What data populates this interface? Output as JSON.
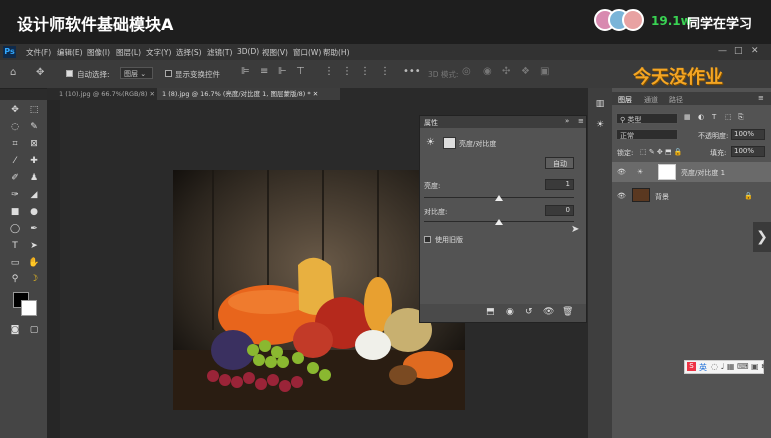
{
  "topbar": {
    "course_title": "设计师软件基础模块A",
    "viewer_count": "19.1w",
    "status_text": "同学在学习"
  },
  "ps": {
    "logo": "Ps",
    "menu": [
      "文件(F)",
      "编辑(E)",
      "图像(I)",
      "图层(L)",
      "文字(Y)",
      "选择(S)",
      "滤镜(T)",
      "3D(D)",
      "视图(V)",
      "窗口(W)",
      "帮助(H)"
    ],
    "window_controls": [
      "—",
      "□",
      "✕"
    ]
  },
  "options": {
    "auto_select_label": "自动选择:",
    "auto_select_value": "图层",
    "show_transform_label": "显示变换控件",
    "mode_3d_label": "3D 模式:"
  },
  "overlay_text": "今天没作业",
  "tabs": [
    {
      "label": "1 (10).jpg @ 66.7%(RGB/8)",
      "close": "✕"
    },
    {
      "label": "1 (8).jpg @ 16.7% (亮度/对比度 1, 图层蒙版/8) *",
      "close": "✕"
    }
  ],
  "properties": {
    "panel_tab": "属性",
    "adjustment_name": "亮度/对比度",
    "auto_button": "自动",
    "brightness_label": "亮度:",
    "brightness_value": "1",
    "contrast_label": "对比度:",
    "contrast_value": "0",
    "legacy_label": "使用旧版",
    "brightness_fraction": 0.5,
    "contrast_fraction": 0.5
  },
  "layers_panel": {
    "tabs": [
      "图层",
      "通道",
      "路径"
    ],
    "filter_kind": "类型",
    "blend_mode": "正常",
    "opacity_label": "不透明度:",
    "opacity_value": "100%",
    "lock_label": "锁定:",
    "fill_label": "填充:",
    "fill_value": "100%",
    "layers": [
      {
        "name": "亮度/对比度 1"
      },
      {
        "name": "背景"
      }
    ]
  },
  "ime": {
    "label": "英"
  },
  "colors": {
    "accent": "#31a8ff",
    "overlay": "#f5a623",
    "viewers": "#39d353"
  }
}
